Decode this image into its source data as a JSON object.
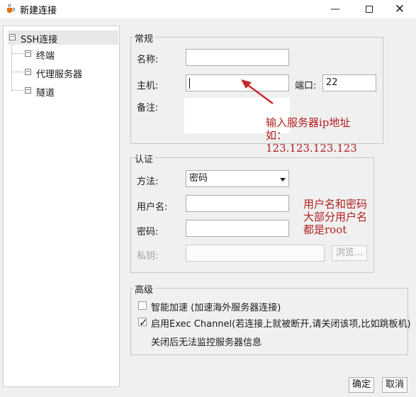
{
  "window": {
    "title": "新建连接",
    "app_icon": "java-cup-icon",
    "controls": [
      "minimize-icon",
      "maximize-icon",
      "close-icon"
    ]
  },
  "tree": {
    "root": "SSH连接",
    "children": [
      "终端",
      "代理服务器",
      "隧道"
    ]
  },
  "general": {
    "legend": "常规",
    "name_label": "名称:",
    "name_value": "",
    "host_label": "主机:",
    "host_value": "",
    "port_label": "端口:",
    "port_value": "22",
    "note_label": "备注:",
    "note_value": ""
  },
  "auth": {
    "legend": "认证",
    "method_label": "方法:",
    "method_value": "密码",
    "user_label": "用户名:",
    "user_value": "",
    "password_label": "密码:",
    "password_value": "",
    "key_label": "私钥:",
    "key_value": "",
    "browse_label": "浏览..."
  },
  "advanced": {
    "legend": "高级",
    "smart_accel_label": "智能加速 (加速海外服务器连接)",
    "smart_accel_checked": false,
    "exec_channel_label": "启用Exec Channel(若连接上就被断开,请关闭该项,比如跳板机)",
    "exec_channel_checked": true,
    "exec_channel_note": "关闭后无法监控服务器信息"
  },
  "footer": {
    "ok_label": "确定",
    "cancel_label": "取消"
  },
  "annotations": {
    "host_note": [
      "输入服务器ip地址",
      "如：",
      "123.123.123.123"
    ],
    "user_note": [
      "用户名和密码",
      "大部分用户名",
      "都是root"
    ],
    "color": "#b21f1f"
  }
}
